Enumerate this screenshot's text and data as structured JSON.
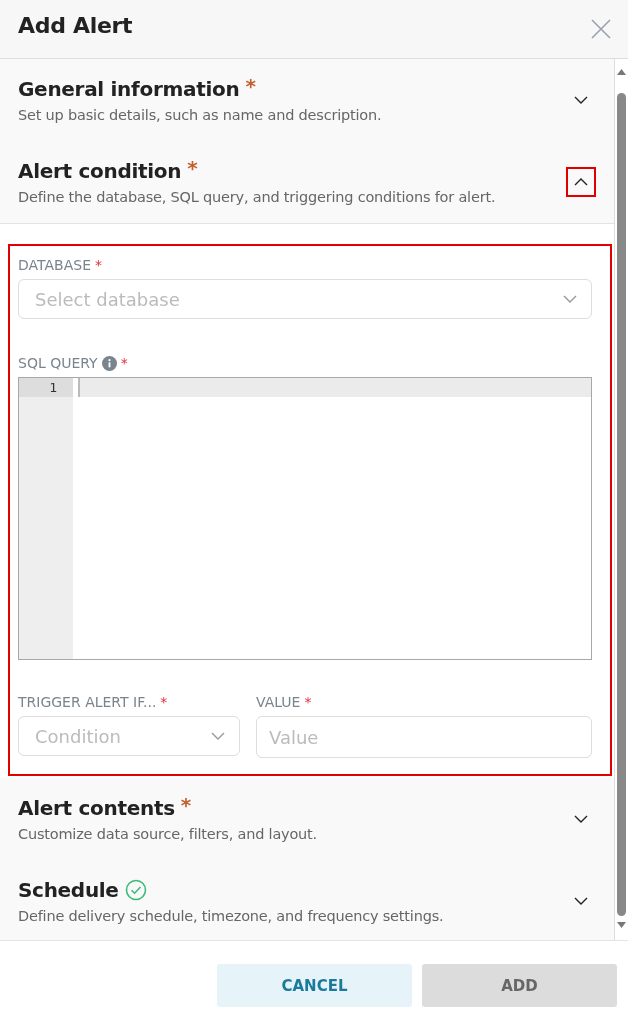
{
  "title": "Add Alert",
  "sections": [
    {
      "title": "General information",
      "required_mark": "*",
      "complete": false,
      "description": "Set up basic details, such as name and description.",
      "expanded": false,
      "highlighted": false
    },
    {
      "title": "Alert condition",
      "required_mark": "*",
      "complete": false,
      "description": "Define the database, SQL query, and triggering conditions for alert.",
      "expanded": true,
      "highlighted": true,
      "content": {
        "highlighted": true,
        "database": {
          "label": "DATABASE",
          "required_mark": "*",
          "placeholder": "Select database"
        },
        "sql_query": {
          "label": "SQL QUERY",
          "required_mark": "*",
          "line_numbers": [
            "1"
          ]
        },
        "trigger": {
          "label": "TRIGGER ALERT IF...",
          "required_mark": "*",
          "placeholder": "Condition"
        },
        "value": {
          "label": "VALUE",
          "required_mark": "*",
          "placeholder": "Value"
        }
      }
    },
    {
      "title": "Alert contents",
      "required_mark": "*",
      "complete": false,
      "description": "Customize data source, filters, and layout.",
      "expanded": false,
      "highlighted": false
    },
    {
      "title": "Schedule",
      "complete": true,
      "description": "Define delivery schedule, timezone, and frequency settings.",
      "expanded": false,
      "highlighted": false
    }
  ],
  "buttons": [
    {
      "label": "CANCEL",
      "kind": "secondary",
      "disabled": false
    },
    {
      "label": "ADD",
      "kind": "primary",
      "disabled": true
    }
  ]
}
